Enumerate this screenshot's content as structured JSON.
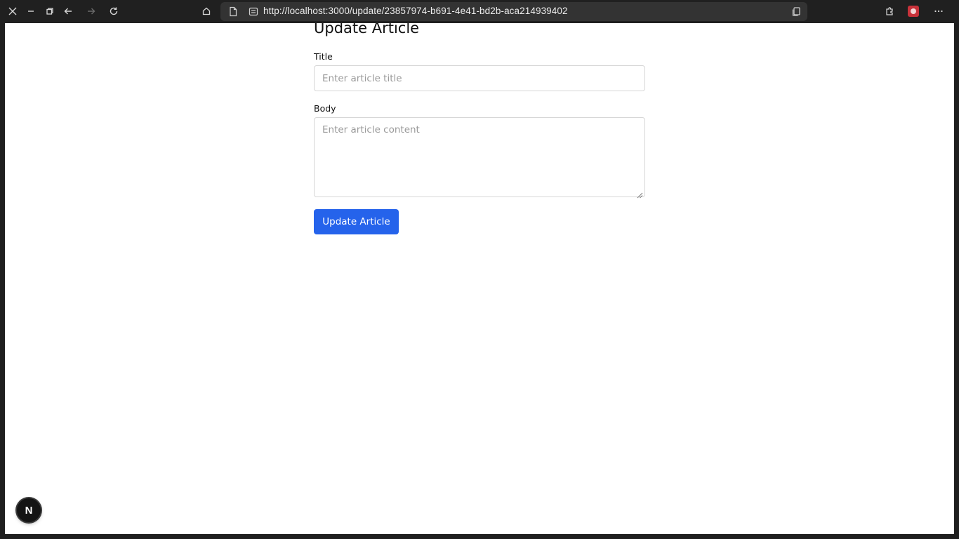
{
  "browser": {
    "url": "http://localhost:3000/update/23857974-b691-4e41-bd2b-aca214939402"
  },
  "page": {
    "title": "Update Article",
    "form": {
      "title_label": "Title",
      "title_placeholder": "Enter article title",
      "title_value": "",
      "body_label": "Body",
      "body_placeholder": "Enter article content",
      "body_value": "",
      "submit_label": "Update Article",
      "submit_color": "#2563eb"
    }
  },
  "dev_badge": {
    "letter": "N"
  }
}
